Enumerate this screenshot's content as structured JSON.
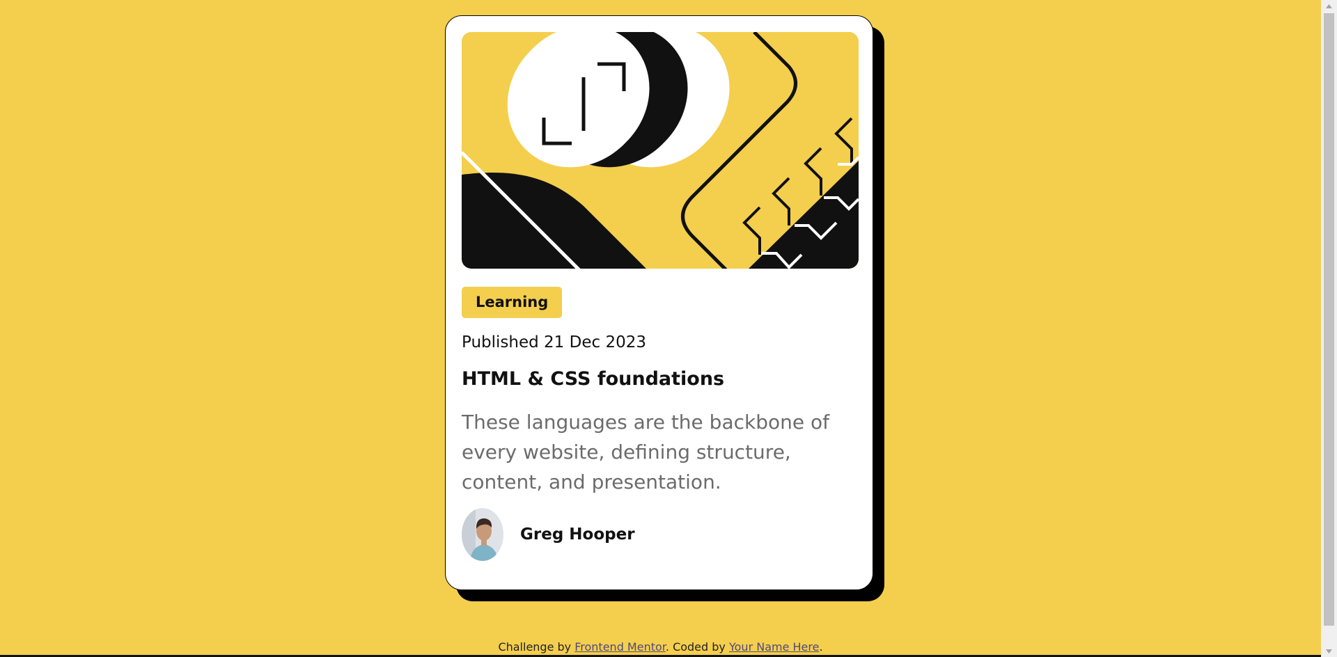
{
  "card": {
    "tag": "Learning",
    "published": "Published 21 Dec 2023",
    "title": "HTML & CSS foundations",
    "description": "These languages are the backbone of every website, defining structure, content, and presentation.",
    "author": "Greg Hooper"
  },
  "footer": {
    "prefix": "Challenge by ",
    "link1": "Frontend Mentor",
    "middle": ". Coded by ",
    "link2": "Your Name Here",
    "suffix": "."
  },
  "colors": {
    "background": "#f4ce4d",
    "card": "#ffffff",
    "text": "#111111",
    "muted": "#6b6b6b"
  }
}
